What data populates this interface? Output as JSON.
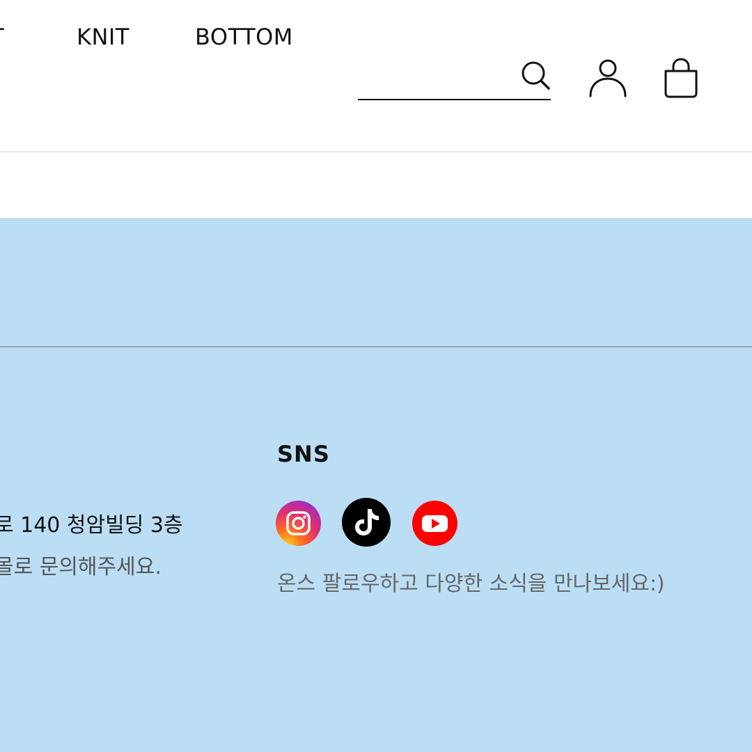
{
  "header": {
    "nav": [
      {
        "label": "T"
      },
      {
        "label": "KNIT"
      },
      {
        "label": "BOTTOM"
      }
    ],
    "search": {
      "placeholder": "",
      "value": ""
    },
    "icons": [
      "search-icon",
      "user-icon",
      "shopping-bag-icon"
    ]
  },
  "footer": {
    "address": "로 140 청암빌딩 3층",
    "inquiry": "몰로 문의해주세요.",
    "sns": {
      "title": "SNS",
      "links": [
        {
          "icon": "instagram-icon",
          "color": "#e1306c"
        },
        {
          "icon": "tiktok-icon",
          "color": "#000000"
        },
        {
          "icon": "youtube-icon",
          "color": "#ff0000"
        }
      ],
      "description": "온스 팔로우하고 다양한 소식을 만나보세요:)"
    }
  },
  "colors": {
    "footer_bg": "#bbdef5",
    "text": "#111111",
    "muted_text": "#666666"
  }
}
